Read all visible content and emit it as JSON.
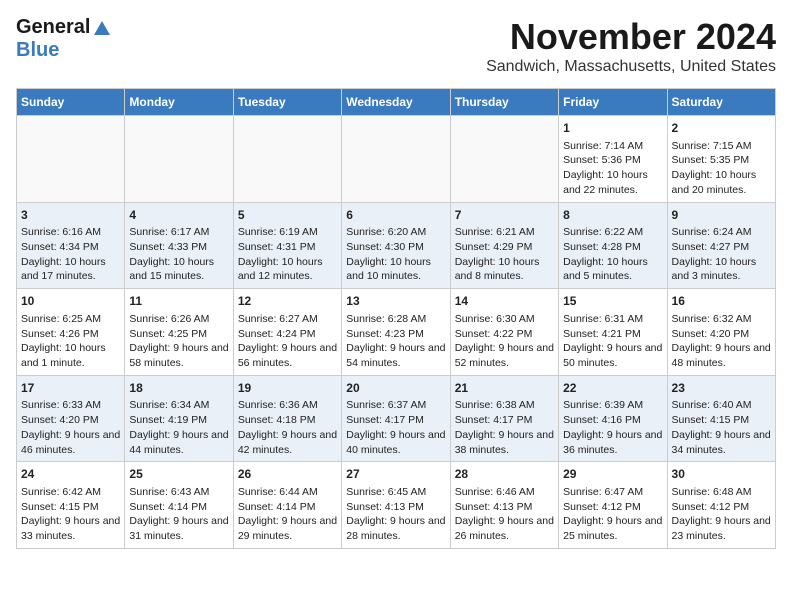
{
  "header": {
    "logo_general": "General",
    "logo_blue": "Blue",
    "title": "November 2024",
    "subtitle": "Sandwich, Massachusetts, United States"
  },
  "weekdays": [
    "Sunday",
    "Monday",
    "Tuesday",
    "Wednesday",
    "Thursday",
    "Friday",
    "Saturday"
  ],
  "weeks": [
    [
      {
        "day": "",
        "info": ""
      },
      {
        "day": "",
        "info": ""
      },
      {
        "day": "",
        "info": ""
      },
      {
        "day": "",
        "info": ""
      },
      {
        "day": "",
        "info": ""
      },
      {
        "day": "1",
        "info": "Sunrise: 7:14 AM\nSunset: 5:36 PM\nDaylight: 10 hours and 22 minutes."
      },
      {
        "day": "2",
        "info": "Sunrise: 7:15 AM\nSunset: 5:35 PM\nDaylight: 10 hours and 20 minutes."
      }
    ],
    [
      {
        "day": "3",
        "info": "Sunrise: 6:16 AM\nSunset: 4:34 PM\nDaylight: 10 hours and 17 minutes."
      },
      {
        "day": "4",
        "info": "Sunrise: 6:17 AM\nSunset: 4:33 PM\nDaylight: 10 hours and 15 minutes."
      },
      {
        "day": "5",
        "info": "Sunrise: 6:19 AM\nSunset: 4:31 PM\nDaylight: 10 hours and 12 minutes."
      },
      {
        "day": "6",
        "info": "Sunrise: 6:20 AM\nSunset: 4:30 PM\nDaylight: 10 hours and 10 minutes."
      },
      {
        "day": "7",
        "info": "Sunrise: 6:21 AM\nSunset: 4:29 PM\nDaylight: 10 hours and 8 minutes."
      },
      {
        "day": "8",
        "info": "Sunrise: 6:22 AM\nSunset: 4:28 PM\nDaylight: 10 hours and 5 minutes."
      },
      {
        "day": "9",
        "info": "Sunrise: 6:24 AM\nSunset: 4:27 PM\nDaylight: 10 hours and 3 minutes."
      }
    ],
    [
      {
        "day": "10",
        "info": "Sunrise: 6:25 AM\nSunset: 4:26 PM\nDaylight: 10 hours and 1 minute."
      },
      {
        "day": "11",
        "info": "Sunrise: 6:26 AM\nSunset: 4:25 PM\nDaylight: 9 hours and 58 minutes."
      },
      {
        "day": "12",
        "info": "Sunrise: 6:27 AM\nSunset: 4:24 PM\nDaylight: 9 hours and 56 minutes."
      },
      {
        "day": "13",
        "info": "Sunrise: 6:28 AM\nSunset: 4:23 PM\nDaylight: 9 hours and 54 minutes."
      },
      {
        "day": "14",
        "info": "Sunrise: 6:30 AM\nSunset: 4:22 PM\nDaylight: 9 hours and 52 minutes."
      },
      {
        "day": "15",
        "info": "Sunrise: 6:31 AM\nSunset: 4:21 PM\nDaylight: 9 hours and 50 minutes."
      },
      {
        "day": "16",
        "info": "Sunrise: 6:32 AM\nSunset: 4:20 PM\nDaylight: 9 hours and 48 minutes."
      }
    ],
    [
      {
        "day": "17",
        "info": "Sunrise: 6:33 AM\nSunset: 4:20 PM\nDaylight: 9 hours and 46 minutes."
      },
      {
        "day": "18",
        "info": "Sunrise: 6:34 AM\nSunset: 4:19 PM\nDaylight: 9 hours and 44 minutes."
      },
      {
        "day": "19",
        "info": "Sunrise: 6:36 AM\nSunset: 4:18 PM\nDaylight: 9 hours and 42 minutes."
      },
      {
        "day": "20",
        "info": "Sunrise: 6:37 AM\nSunset: 4:17 PM\nDaylight: 9 hours and 40 minutes."
      },
      {
        "day": "21",
        "info": "Sunrise: 6:38 AM\nSunset: 4:17 PM\nDaylight: 9 hours and 38 minutes."
      },
      {
        "day": "22",
        "info": "Sunrise: 6:39 AM\nSunset: 4:16 PM\nDaylight: 9 hours and 36 minutes."
      },
      {
        "day": "23",
        "info": "Sunrise: 6:40 AM\nSunset: 4:15 PM\nDaylight: 9 hours and 34 minutes."
      }
    ],
    [
      {
        "day": "24",
        "info": "Sunrise: 6:42 AM\nSunset: 4:15 PM\nDaylight: 9 hours and 33 minutes."
      },
      {
        "day": "25",
        "info": "Sunrise: 6:43 AM\nSunset: 4:14 PM\nDaylight: 9 hours and 31 minutes."
      },
      {
        "day": "26",
        "info": "Sunrise: 6:44 AM\nSunset: 4:14 PM\nDaylight: 9 hours and 29 minutes."
      },
      {
        "day": "27",
        "info": "Sunrise: 6:45 AM\nSunset: 4:13 PM\nDaylight: 9 hours and 28 minutes."
      },
      {
        "day": "28",
        "info": "Sunrise: 6:46 AM\nSunset: 4:13 PM\nDaylight: 9 hours and 26 minutes."
      },
      {
        "day": "29",
        "info": "Sunrise: 6:47 AM\nSunset: 4:12 PM\nDaylight: 9 hours and 25 minutes."
      },
      {
        "day": "30",
        "info": "Sunrise: 6:48 AM\nSunset: 4:12 PM\nDaylight: 9 hours and 23 minutes."
      }
    ]
  ]
}
